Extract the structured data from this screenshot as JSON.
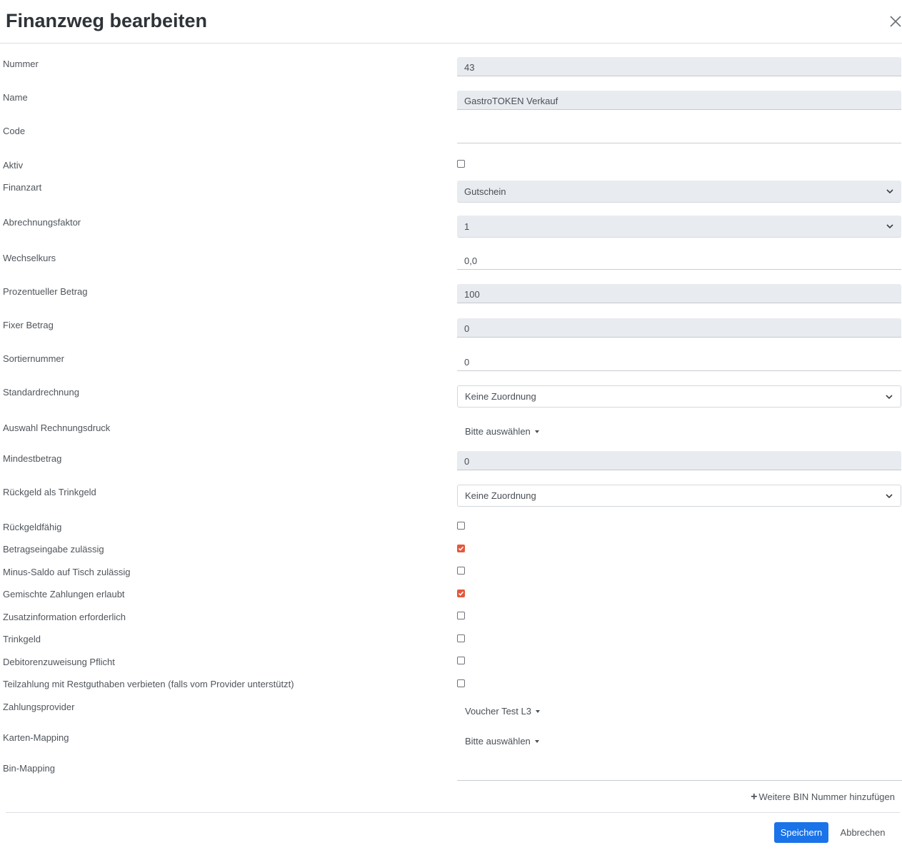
{
  "dialog": {
    "title": "Finanzweg bearbeiten",
    "close_icon": "close-icon"
  },
  "fields": {
    "nummer": {
      "label": "Nummer",
      "value": "43"
    },
    "name": {
      "label": "Name",
      "value": "GastroTOKEN Verkauf"
    },
    "code": {
      "label": "Code",
      "value": ""
    },
    "aktiv": {
      "label": "Aktiv",
      "checked": false
    },
    "finanzart": {
      "label": "Finanzart",
      "value": "Gutschein"
    },
    "abrechnungsfaktor": {
      "label": "Abrechnungsfaktor",
      "value": "1"
    },
    "wechselkurs": {
      "label": "Wechselkurs",
      "value": "0,0"
    },
    "prozentueller_betrag": {
      "label": "Prozentueller Betrag",
      "value": "100"
    },
    "fixer_betrag": {
      "label": "Fixer Betrag",
      "value": "0"
    },
    "sortiernummer": {
      "label": "Sortiernummer",
      "value": "0"
    },
    "standardrechnung": {
      "label": "Standardrechnung",
      "value": "Keine Zuordnung"
    },
    "auswahl_rechnungsdruck": {
      "label": "Auswahl Rechnungsdruck",
      "value": "Bitte auswählen"
    },
    "mindestbetrag": {
      "label": "Mindestbetrag",
      "value": "0"
    },
    "rueckgeld_trinkgeld": {
      "label": "Rückgeld als Trinkgeld",
      "value": "Keine Zuordnung"
    },
    "rueckgeldfaehig": {
      "label": "Rückgeldfähig",
      "checked": false
    },
    "betragseingabe": {
      "label": "Betragseingabe zulässig",
      "checked": true
    },
    "minus_saldo": {
      "label": "Minus-Saldo auf Tisch zulässig",
      "checked": false
    },
    "gemischte_zahlungen": {
      "label": "Gemischte Zahlungen erlaubt",
      "checked": true
    },
    "zusatzinformation": {
      "label": "Zusatzinformation erforderlich",
      "checked": false
    },
    "trinkgeld": {
      "label": "Trinkgeld",
      "checked": false
    },
    "debitorenzuweisung": {
      "label": "Debitorenzuweisung Pflicht",
      "checked": false
    },
    "teilzahlung": {
      "label": "Teilzahlung mit Restguthaben verbieten (falls vom Provider unterstützt)",
      "checked": false
    },
    "zahlungsprovider": {
      "label": "Zahlungsprovider",
      "value": "Voucher Test L3"
    },
    "karten_mapping": {
      "label": "Karten-Mapping",
      "value": "Bitte auswählen"
    },
    "bin_mapping": {
      "label": "Bin-Mapping",
      "add_label": "Weitere BIN Nummer hinzufügen"
    }
  },
  "footer": {
    "save_label": "Speichern",
    "cancel_label": "Abbrechen"
  },
  "colors": {
    "primary": "#1a73e8",
    "checkbox_checked": "#e4583e",
    "readonly_bg": "#e8ebef"
  }
}
